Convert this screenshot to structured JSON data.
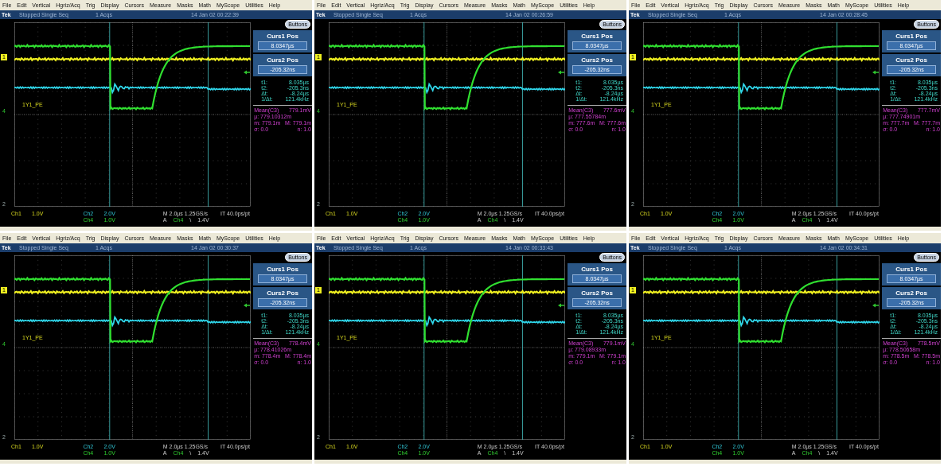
{
  "panels": [
    {
      "menu": [
        "File",
        "Edit",
        "Vertical",
        "Hgriz/Acq",
        "Trig",
        "Display",
        "Cursors",
        "Measure",
        "Masks",
        "Math",
        "MyScope",
        "Utilities",
        "Help"
      ],
      "status": {
        "brand": "Tek",
        "state": "Stopped  Single Seq",
        "acqs": "1 Acqs",
        "timestamp": "14 Jan 02 00:22:39"
      },
      "buttons": "Buttons",
      "cursors": [
        {
          "label": "Curs1 Pos",
          "value": "8.0347µs"
        },
        {
          "label": "Curs2 Pos",
          "value": "-205.32ns"
        }
      ],
      "readouts": [
        {
          "name": "t1:",
          "value": "8.035µs"
        },
        {
          "name": "t2:",
          "value": "-205.3ns"
        },
        {
          "name": "Δt:",
          "value": "-8.24µs"
        },
        {
          "name": "1/Δt:",
          "value": "121.4kHz"
        }
      ],
      "measurement": [
        {
          "left": "Mean(C3)",
          "right": "779.1mV"
        },
        {
          "left": "µ: 779.10312m"
        },
        {
          "left": "m: 779.1m",
          "right": "M: 779.1m"
        },
        {
          "left": "σ: 0.0",
          "right": "n: 1.0"
        }
      ],
      "markers": {
        "ch1": "1",
        "ch4": "4",
        "ch2": "2"
      },
      "trace_label": "1Y1_PE",
      "footer": [
        {
          "text": "Ch1",
          "kind": "ch1"
        },
        {
          "text": "1.0V",
          "kind": "ch1"
        },
        {
          "text": "Ch2",
          "kind": "ch2"
        },
        {
          "text": "2.0V",
          "kind": "ch2"
        },
        {
          "text": "Ch4",
          "kind": "ch4"
        },
        {
          "text": "1.0V",
          "kind": "ch4"
        }
      ],
      "timebase": "M 2.0µs 1.25GS/s",
      "resolution": "IT 40.0ps/pt",
      "trigger": {
        "prefix": "A",
        "source": "Ch4",
        "slope": "\\",
        "level": "1.4V"
      }
    },
    {
      "menu": [
        "File",
        "Edit",
        "Vertical",
        "Hgriz/Acq",
        "Trig",
        "Display",
        "Cursors",
        "Measure",
        "Masks",
        "Math",
        "MyScope",
        "Utilities",
        "Help"
      ],
      "status": {
        "brand": "Tek",
        "state": "Stopped  Single Seq",
        "acqs": "1 Acqs",
        "timestamp": "14 Jan 02 00:26:59"
      },
      "buttons": "Buttons",
      "cursors": [
        {
          "label": "Curs1 Pos",
          "value": "8.0347µs"
        },
        {
          "label": "Curs2 Pos",
          "value": "-205.32ns"
        }
      ],
      "readouts": [
        {
          "name": "t1:",
          "value": "8.035µs"
        },
        {
          "name": "t2:",
          "value": "-205.3ns"
        },
        {
          "name": "Δt:",
          "value": "-8.24µs"
        },
        {
          "name": "1/Δt:",
          "value": "121.4kHz"
        }
      ],
      "measurement": [
        {
          "left": "Mean(C3)",
          "right": "777.6mV"
        },
        {
          "left": "µ: 777.55784m"
        },
        {
          "left": "m: 777.6m",
          "right": "M: 777.6m"
        },
        {
          "left": "σ: 0.0",
          "right": "n: 1.0"
        }
      ],
      "markers": {
        "ch1": "1",
        "ch4": "4",
        "ch2": "2"
      },
      "trace_label": "1Y1_PE",
      "footer": [
        {
          "text": "Ch1",
          "kind": "ch1"
        },
        {
          "text": "1.0V",
          "kind": "ch1"
        },
        {
          "text": "Ch2",
          "kind": "ch2"
        },
        {
          "text": "2.0V",
          "kind": "ch2"
        },
        {
          "text": "Ch4",
          "kind": "ch4"
        },
        {
          "text": "1.0V",
          "kind": "ch4"
        }
      ],
      "timebase": "M 2.0µs 1.25GS/s",
      "resolution": "IT 40.0ps/pt",
      "trigger": {
        "prefix": "A",
        "source": "Ch4",
        "slope": "\\",
        "level": "1.4V"
      }
    },
    {
      "menu": [
        "File",
        "Edit",
        "Vertical",
        "Hgriz/Acq",
        "Trig",
        "Display",
        "Cursors",
        "Measure",
        "Masks",
        "Math",
        "MyScope",
        "Utilities",
        "Help"
      ],
      "status": {
        "brand": "Tek",
        "state": "Stopped  Single Seq",
        "acqs": "1 Acqs",
        "timestamp": "14 Jan 02 00:28:45"
      },
      "buttons": "Buttons",
      "cursors": [
        {
          "label": "Curs1 Pos",
          "value": "8.0347µs"
        },
        {
          "label": "Curs2 Pos",
          "value": "-205.32ns"
        }
      ],
      "readouts": [
        {
          "name": "t1:",
          "value": "8.035µs"
        },
        {
          "name": "t2:",
          "value": "-205.3ns"
        },
        {
          "name": "Δt:",
          "value": "-8.24µs"
        },
        {
          "name": "1/Δt:",
          "value": "121.4kHz"
        }
      ],
      "measurement": [
        {
          "left": "Mean(C3)",
          "right": "777.7mV"
        },
        {
          "left": "µ: 777.74901m"
        },
        {
          "left": "m: 777.7m",
          "right": "M: 777.7m"
        },
        {
          "left": "σ: 0.0",
          "right": "n: 1.0"
        }
      ],
      "markers": {
        "ch1": "1",
        "ch4": "4",
        "ch2": "2"
      },
      "trace_label": "1Y1_PE",
      "footer": [
        {
          "text": "Ch1",
          "kind": "ch1"
        },
        {
          "text": "1.0V",
          "kind": "ch1"
        },
        {
          "text": "Ch2",
          "kind": "ch2"
        },
        {
          "text": "2.0V",
          "kind": "ch2"
        },
        {
          "text": "Ch4",
          "kind": "ch4"
        },
        {
          "text": "1.0V",
          "kind": "ch4"
        }
      ],
      "timebase": "M 2.0µs 1.25GS/s",
      "resolution": "IT 40.0ps/pt",
      "trigger": {
        "prefix": "A",
        "source": "Ch4",
        "slope": "\\",
        "level": "1.4V"
      }
    },
    {
      "menu": [
        "File",
        "Edit",
        "Vertical",
        "Hgriz/Acq",
        "Trig",
        "Display",
        "Cursors",
        "Measure",
        "Masks",
        "Math",
        "MyScope",
        "Utilities",
        "Help"
      ],
      "status": {
        "brand": "Tek",
        "state": "Stopped  Single Seq",
        "acqs": "1 Acqs",
        "timestamp": "14 Jan 02 00:30:37"
      },
      "buttons": "Buttons",
      "cursors": [
        {
          "label": "Curs1 Pos",
          "value": "8.0347µs"
        },
        {
          "label": "Curs2 Pos",
          "value": "-205.32ns"
        }
      ],
      "readouts": [
        {
          "name": "t1:",
          "value": "8.035µs"
        },
        {
          "name": "t2:",
          "value": "-205.3ns"
        },
        {
          "name": "Δt:",
          "value": "-8.24µs"
        },
        {
          "name": "1/Δt:",
          "value": "121.4kHz"
        }
      ],
      "measurement": [
        {
          "left": "Mean(C3)",
          "right": "778.4mV"
        },
        {
          "left": "µ: 778.41026m"
        },
        {
          "left": "m: 778.4m",
          "right": "M: 778.4m"
        },
        {
          "left": "σ: 0.0",
          "right": "n: 1.0"
        }
      ],
      "markers": {
        "ch1": "1",
        "ch4": "4",
        "ch2": "2"
      },
      "trace_label": "1Y1_PE",
      "footer": [
        {
          "text": "Ch1",
          "kind": "ch1"
        },
        {
          "text": "1.0V",
          "kind": "ch1"
        },
        {
          "text": "Ch2",
          "kind": "ch2"
        },
        {
          "text": "2.0V",
          "kind": "ch2"
        },
        {
          "text": "Ch4",
          "kind": "ch4"
        },
        {
          "text": "1.0V",
          "kind": "ch4"
        }
      ],
      "timebase": "M 2.0µs 1.25GS/s",
      "resolution": "IT 40.0ps/pt",
      "trigger": {
        "prefix": "A",
        "source": "Ch4",
        "slope": "\\",
        "level": "1.4V"
      }
    },
    {
      "menu": [
        "File",
        "Edit",
        "Vertical",
        "Hgriz/Acq",
        "Trig",
        "Display",
        "Cursors",
        "Measure",
        "Masks",
        "Math",
        "MyScope",
        "Utilities",
        "Help"
      ],
      "status": {
        "brand": "Tek",
        "state": "Stopped  Single Seq",
        "acqs": "1 Acqs",
        "timestamp": "14 Jan 02 00:33:43"
      },
      "buttons": "Buttons",
      "cursors": [
        {
          "label": "Curs1 Pos",
          "value": "8.0347µs"
        },
        {
          "label": "Curs2 Pos",
          "value": "-205.32ns"
        }
      ],
      "readouts": [
        {
          "name": "t1:",
          "value": "8.035µs"
        },
        {
          "name": "t2:",
          "value": "-205.3ns"
        },
        {
          "name": "Δt:",
          "value": "-8.24µs"
        },
        {
          "name": "1/Δt:",
          "value": "121.4kHz"
        }
      ],
      "measurement": [
        {
          "left": "Mean(C3)",
          "right": "779.1mV"
        },
        {
          "left": "µ: 779.08933m"
        },
        {
          "left": "m: 779.1m",
          "right": "M: 779.1m"
        },
        {
          "left": "σ: 0.0",
          "right": "n: 1.0"
        }
      ],
      "markers": {
        "ch1": "1",
        "ch4": "4",
        "ch2": "2"
      },
      "trace_label": "1Y1_PE",
      "footer": [
        {
          "text": "Ch1",
          "kind": "ch1"
        },
        {
          "text": "1.0V",
          "kind": "ch1"
        },
        {
          "text": "Ch2",
          "kind": "ch2"
        },
        {
          "text": "2.0V",
          "kind": "ch2"
        },
        {
          "text": "Ch4",
          "kind": "ch4"
        },
        {
          "text": "1.0V",
          "kind": "ch4"
        }
      ],
      "timebase": "M 2.0µs 1.25GS/s",
      "resolution": "IT 40.0ps/pt",
      "trigger": {
        "prefix": "A",
        "source": "Ch4",
        "slope": "\\",
        "level": "1.4V"
      }
    },
    {
      "menu": [
        "File",
        "Edit",
        "Vertical",
        "Hgriz/Acq",
        "Trig",
        "Display",
        "Cursors",
        "Measure",
        "Masks",
        "Math",
        "MyScope",
        "Utilities",
        "Help"
      ],
      "status": {
        "brand": "Tek",
        "state": "Stopped  Single Seq",
        "acqs": "1 Acqs",
        "timestamp": "14 Jan 02 00:34:31"
      },
      "buttons": "Buttons",
      "cursors": [
        {
          "label": "Curs1 Pos",
          "value": "8.0347µs"
        },
        {
          "label": "Curs2 Pos",
          "value": "-205.32ns"
        }
      ],
      "readouts": [
        {
          "name": "t1:",
          "value": "8.035µs"
        },
        {
          "name": "t2:",
          "value": "-205.3ns"
        },
        {
          "name": "Δt:",
          "value": "-8.24µs"
        },
        {
          "name": "1/Δt:",
          "value": "121.4kHz"
        }
      ],
      "measurement": [
        {
          "left": "Mean(C3)",
          "right": "778.5mV"
        },
        {
          "left": "µ: 778.50658m"
        },
        {
          "left": "m: 778.5m",
          "right": "M: 778.5m"
        },
        {
          "left": "σ: 0.0",
          "right": "n: 1.0"
        }
      ],
      "markers": {
        "ch1": "1",
        "ch4": "4",
        "ch2": "2"
      },
      "trace_label": "1Y1_PE",
      "footer": [
        {
          "text": "Ch1",
          "kind": "ch1"
        },
        {
          "text": "1.0V",
          "kind": "ch1"
        },
        {
          "text": "Ch2",
          "kind": "ch2"
        },
        {
          "text": "2.0V",
          "kind": "ch2"
        },
        {
          "text": "Ch4",
          "kind": "ch4"
        },
        {
          "text": "1.0V",
          "kind": "ch4"
        }
      ],
      "timebase": "M 2.0µs 1.25GS/s",
      "resolution": "IT 40.0ps/pt",
      "trigger": {
        "prefix": "A",
        "source": "Ch4",
        "slope": "\\",
        "level": "1.4V"
      }
    }
  ]
}
